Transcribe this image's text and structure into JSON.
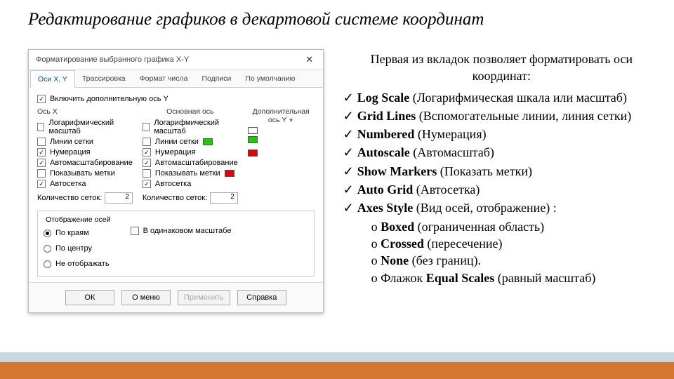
{
  "slide": {
    "title": "Редактирование графиков в декартовой системе координат"
  },
  "dialog": {
    "title": "Форматирование выбранного графика X-Y",
    "tabs": [
      "Оси X, Y",
      "Трассировка",
      "Формат числа",
      "Подписи",
      "По умолчанию"
    ],
    "extra_axis": "Включить дополнительную ось Y",
    "col_headers": {
      "x": "Ось X",
      "primary": "Основная ось",
      "secondary": "Дополнительная ось Y"
    },
    "opts": {
      "log": "Логарифмический масштаб",
      "grid": "Линии сетки",
      "num": "Нумерация",
      "auto": "Автомасштабирование",
      "markers": "Показывать метки",
      "autogrid": "Автосетка"
    },
    "grid_count": "Количество сеток:",
    "grid_val_x": "2",
    "grid_val_y": "2",
    "axes_style": {
      "legend": "Отображение осей",
      "boxed": "По краям",
      "crossed": "По центру",
      "none": "Не отображать",
      "equal": "В одинаковом масштабе"
    },
    "buttons": {
      "ok": "ОК",
      "about": "О меню",
      "apply": "Применить",
      "help": "Справка"
    }
  },
  "explain": {
    "intro": "Первая из вкладок позволяет форматировать оси координат:",
    "items": [
      {
        "b": "Log Scale",
        "t": " (Логарифмическая шкала или масштаб)"
      },
      {
        "b": "Grid Lines",
        "t": " (Вспомогательные линии, линия сетки)"
      },
      {
        "b": "Numbered",
        "t": " (Нумерация)"
      },
      {
        "b": "Autoscale",
        "t": " (Автомасштаб)"
      },
      {
        "b": "Show Markers",
        "t": " (Показать метки)"
      },
      {
        "b": "Auto Grid",
        "t": " (Автосетка)"
      },
      {
        "b": "Axes Style",
        "t": " (Вид осей, отображение) :"
      }
    ],
    "sub": [
      {
        "b": "Boxed",
        "t": " (ограниченная область)"
      },
      {
        "b": "Crossed",
        "t": " (пересечение)"
      },
      {
        "b": "None",
        "t": " (без границ)."
      },
      {
        "pre": "Флажок ",
        "b": "Equal Scales",
        "t": " (равный масштаб)"
      }
    ]
  }
}
